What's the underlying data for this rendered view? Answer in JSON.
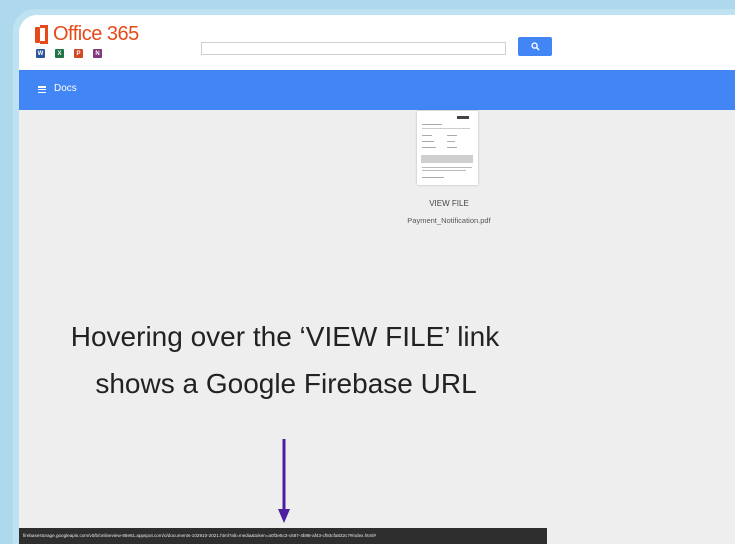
{
  "header": {
    "logo_text": "Office 365",
    "apps": [
      {
        "icon": "word-icon",
        "letter": "W",
        "color": "#2b579a"
      },
      {
        "icon": "excel-icon",
        "letter": "X",
        "color": "#217346"
      },
      {
        "icon": "powerpoint-icon",
        "letter": "P",
        "color": "#d24726"
      },
      {
        "icon": "onenote-icon",
        "letter": "N",
        "color": "#80397b"
      }
    ],
    "search": {
      "value": "",
      "placeholder": ""
    },
    "search_button_icon": "search-icon"
  },
  "navbar": {
    "menu_icon": "hamburger-menu-icon",
    "title": "Docs"
  },
  "document": {
    "thumbnail_icon": "pdf-thumbnail",
    "link_label": "VIEW FILE",
    "file_name": "Payment_Notification.pdf"
  },
  "caption": {
    "line1": "Hovering over the ‘VIEW FILE’ link",
    "line2": "shows a Google Firebase URL"
  },
  "arrow_icon": "down-arrow-icon",
  "status_bar": {
    "url": "firebasestorage.googleapis.com/v0/b/onlineview-88e61.appspot.com/o/documents-102910-2021.html?alt=media&token=a0f3e5c3-c687-4b98-af43-cf93cfa832c7#index.html#"
  },
  "colors": {
    "brand": "#e64a19",
    "navbar": "#4285f4",
    "frame": "#bfe2f2",
    "arrow": "#4b1fa0"
  }
}
